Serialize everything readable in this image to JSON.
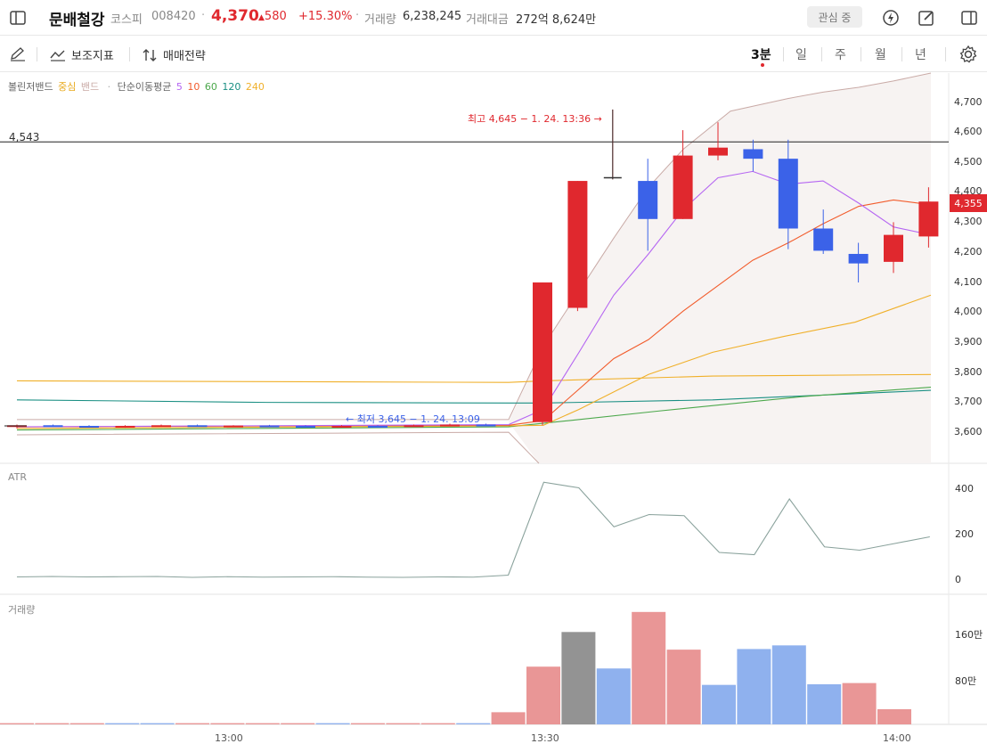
{
  "header": {
    "name": "문배철강",
    "exchange": "코스피",
    "code": "008420",
    "price": "4,370",
    "change": "580",
    "change_pct": "+15.30%",
    "volume_label": "거래량",
    "volume_value": "6,238,245",
    "amount_label": "거래대금",
    "amount_value": "272억 8,624만",
    "watch_label": "관심 중"
  },
  "toolbar": {
    "indicator_label": "보조지표",
    "strategy_label": "매매전략",
    "timeframes": [
      "3분",
      "일",
      "주",
      "월",
      "년"
    ],
    "active_timeframe": "3분"
  },
  "legend": {
    "bollinger": "볼린저밴드",
    "center": "중심",
    "band": "밴드",
    "sep": "·",
    "ma_label": "단순이동평균",
    "ma5": "5",
    "ma10": "10",
    "ma60": "60",
    "ma120": "120",
    "ma240": "240"
  },
  "colors": {
    "up": "#e0282e",
    "down": "#3b62e8",
    "ma5": "#b565f2",
    "ma10": "#f25c2c",
    "ma60": "#4ca84c",
    "ma120": "#1a8f83",
    "ma240": "#f0b02a",
    "band": "#c9aaa6"
  },
  "price_panel": {
    "hline_value": "4,543",
    "high_annotation": "최고 4,645 − 1. 24. 13:36 →",
    "low_annotation": "← 최저 3,645 − 1. 24. 13:09",
    "current_tag": "4,355",
    "y_ticks": [
      "4,700",
      "4,600",
      "4,500",
      "4,400",
      "4,300",
      "4,200",
      "4,100",
      "4,000",
      "3,900",
      "3,800",
      "3,700",
      "3,600"
    ]
  },
  "atr_panel": {
    "title": "ATR",
    "y_ticks": [
      "400",
      "200",
      "0"
    ]
  },
  "volume_panel": {
    "title": "거래량",
    "y_ticks": [
      "160만",
      "80만"
    ]
  },
  "x_ticks": [
    "13:00",
    "13:30",
    "14:00"
  ],
  "chart_data": {
    "type": "candlestick",
    "title": "",
    "x": [
      "12:57",
      "13:00",
      "13:03",
      "13:06",
      "13:09",
      "13:12",
      "13:15",
      "13:18",
      "13:21",
      "13:24",
      "13:27",
      "13:30",
      "13:33",
      "13:36",
      "13:39",
      "13:42",
      "13:45",
      "13:48",
      "13:51",
      "13:54",
      "13:57",
      "14:00",
      "14:03"
    ],
    "candles": [
      {
        "o": 3645,
        "h": 3652,
        "l": 3640,
        "c": 3650
      },
      {
        "o": 3650,
        "h": 3652,
        "l": 3645,
        "c": 3648
      },
      {
        "o": 3648,
        "h": 3650,
        "l": 3643,
        "c": 3645
      },
      {
        "o": 3645,
        "h": 3650,
        "l": 3642,
        "c": 3648
      },
      {
        "o": 3648,
        "h": 3652,
        "l": 3645,
        "c": 3650
      },
      {
        "o": 3650,
        "h": 3652,
        "l": 3645,
        "c": 3647
      },
      {
        "o": 3647,
        "h": 3650,
        "l": 3645,
        "c": 3649
      },
      {
        "o": 3649,
        "h": 3651,
        "l": 3646,
        "c": 3648
      },
      {
        "o": 3648,
        "h": 3650,
        "l": 3645,
        "c": 3646
      },
      {
        "o": 3646,
        "h": 3650,
        "l": 3645,
        "c": 3648
      },
      {
        "o": 3648,
        "h": 3650,
        "l": 3645,
        "c": 3647
      },
      {
        "o": 3647,
        "h": 3652,
        "l": 3645,
        "c": 3650
      },
      {
        "o": 3650,
        "h": 3655,
        "l": 3647,
        "c": 3652
      },
      {
        "o": 3652,
        "h": 3655,
        "l": 3648,
        "c": 3650
      },
      {
        "o": 3660,
        "h": 4100,
        "l": 3650,
        "c": 4100
      },
      {
        "o": 4020,
        "h": 4420,
        "l": 4010,
        "c": 4420
      },
      {
        "o": 4425,
        "h": 4645,
        "l": 4425,
        "c": 4430
      },
      {
        "o": 4420,
        "h": 4490,
        "l": 4200,
        "c": 4300
      },
      {
        "o": 4300,
        "h": 4580,
        "l": 4300,
        "c": 4500
      },
      {
        "o": 4500,
        "h": 4605,
        "l": 4485,
        "c": 4525
      },
      {
        "o": 4520,
        "h": 4550,
        "l": 4450,
        "c": 4490
      },
      {
        "o": 4490,
        "h": 4550,
        "l": 4205,
        "c": 4270
      },
      {
        "o": 4270,
        "h": 4330,
        "l": 4190,
        "c": 4200
      }
    ],
    "candles_tail": [
      {
        "o": 4190,
        "h": 4225,
        "l": 4100,
        "c": 4160
      },
      {
        "o": 4165,
        "h": 4290,
        "l": 4130,
        "c": 4250
      },
      {
        "o": 4245,
        "h": 4400,
        "l": 4210,
        "c": 4355
      }
    ],
    "atr": [
      10,
      12,
      10,
      11,
      12,
      8,
      11,
      9,
      10,
      11,
      9,
      8,
      10,
      9,
      18,
      435,
      410,
      235,
      290,
      285,
      120,
      110,
      360,
      145,
      130,
      160,
      190
    ],
    "volume_k": [
      2,
      2,
      2,
      2,
      2,
      2,
      2,
      2,
      2,
      2,
      2,
      2,
      2,
      2,
      20,
      95,
      152,
      92,
      185,
      123,
      65,
      124,
      130,
      66,
      68,
      25
    ],
    "volume_colors": [
      "up",
      "up",
      "up",
      "down",
      "down",
      "up",
      "up",
      "up",
      "up",
      "down",
      "up",
      "up",
      "up",
      "down",
      "up",
      "up",
      "neutral",
      "down",
      "up",
      "up",
      "down",
      "down",
      "down",
      "down",
      "up",
      "up"
    ],
    "ylim_price": [
      3530,
      4760
    ],
    "ylim_atr": [
      0,
      460
    ],
    "ylim_volume_k": [
      0,
      195
    ]
  }
}
